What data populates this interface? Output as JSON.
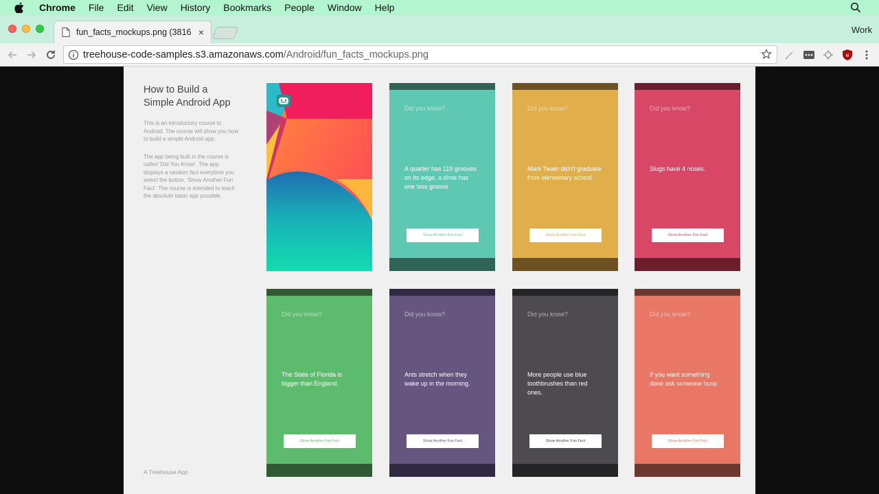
{
  "menubar": {
    "app": "Chrome",
    "items": [
      "File",
      "Edit",
      "View",
      "History",
      "Bookmarks",
      "People",
      "Window",
      "Help"
    ]
  },
  "tab": {
    "title": "fun_facts_mockups.png (3816",
    "close": "×"
  },
  "profile": "Work",
  "toolbar": {
    "url_host": "treehouse-code-samples.s3.amazonaws.com",
    "url_path": "/Android/fun_facts_mockups.png"
  },
  "mockup": {
    "heading": "How to Build a Simple Android App",
    "para1": "This is an introductory course to Android. The course will show you how to build a simple Android app.",
    "para2": "The app being built in the course is called 'Did You Know'. The app displays a random fact everytime you select the button, 'Show Another Fun Fact'. The course is intended to teach the absolute basic app possible.",
    "footer": "A Treehouse App",
    "question": "Did you know?",
    "button": "Show Another Fun Fact",
    "phones": [
      {
        "fact": "A quarter has 119 grooves on its edge, a dime has one less groove",
        "color": "#5fc8b2",
        "bar": "#2e6356"
      },
      {
        "fact": "Mark Twain didn't graduate from elementary school.",
        "color": "#e0ae4a",
        "bar": "#6e5122"
      },
      {
        "fact": "Slugs have 4 noses.",
        "color": "#d84766",
        "bar": "#6b1f2d"
      },
      {
        "fact": "The State of Florida is bigger than England.",
        "color": "#5dbb6e",
        "bar": "#2f5a34"
      },
      {
        "fact": "Ants stretch when they wake up in the morning.",
        "color": "#64567f",
        "bar": "#302941"
      },
      {
        "fact": "More people use blue toothbrushes than red ones.",
        "color": "#4d4b4f",
        "bar": "#242326"
      },
      {
        "fact": "If you want something done ask someone busy.",
        "color": "#e87766",
        "bar": "#6d3830"
      }
    ]
  }
}
